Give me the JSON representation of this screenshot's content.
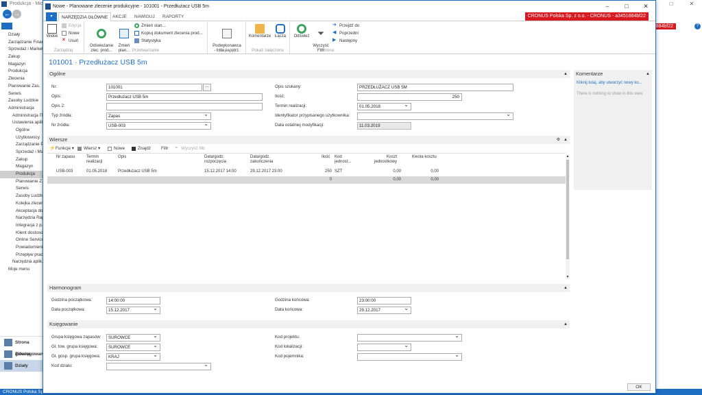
{
  "background": {
    "title": "Produkcja - Mic...",
    "company_status": "CRONUS Polska Sp. z o.o.",
    "red_badge": "o. - a3451884bf22",
    "nav_items": [
      "Działy",
      "Zarządzanie Finansami",
      "Sprzedaż i Marketing",
      "Zakup",
      "Magazyn",
      "Produkcja",
      "Zlecenia",
      "Planowanie Zas.",
      "Serwis",
      "Zasoby Ludzkie",
      "Administracja",
      "Administracja IT",
      "Ustawienia aplikacji",
      "Ogólne",
      "Użytkownicy",
      "Zarządzanie Pr.",
      "Sprzedaż i Ma.",
      "Zakup",
      "Magazyn",
      "Produkcja",
      "Planowanie Z.",
      "Serwis",
      "Zasoby Ludzk.",
      "Kolejka zlecenia",
      "Akceptacja do.",
      "Narzędzia Rap.",
      "Integracja z p.",
      "Klient dostosow.",
      "Online Service",
      "Powiadomienia",
      "Przepływ prac.",
      "Narzędzia aplik.",
      "Moje menu"
    ],
    "bottom_items": [
      "Strona główna",
      "Zaksięgowane",
      "Działy"
    ],
    "win_controls": [
      "–",
      "□",
      "✕"
    ]
  },
  "dialog": {
    "title": "Nowe - Planowane zlecenie produkcyjne - 101001 - Przedłużacz USB 5m",
    "controls": [
      "–",
      "□",
      "✕"
    ],
    "company_badge": "CRONUS Polska Sp. z o.o. - CRONUS - a3451884bf22",
    "tabs": [
      "NARZĘDZIA GŁÓWNE",
      "AKCJE",
      "NAWIGUJ",
      "RAPORTY"
    ],
    "ribbon": {
      "zarzadzaj": {
        "label": "Zarządzaj",
        "widok": "Widok",
        "edycja": "Edycja",
        "nowe": "Nowe",
        "usun": "Usuń"
      },
      "przetwarzanie": {
        "label": "Przetwarzanie",
        "odswiezanie": "Odświeżanie\nzlec. prod...",
        "zmien_plan": "Zmień\nplan...",
        "zmien_stan": "Zmień stan...",
        "kopiuj": "Kopiuj dokument zlecenia prod...",
        "statystyka": "Statystyka"
      },
      "raporty": {
        "label": "Raporty",
        "podwykonawca": "Podwykonawca\n- lista zapotrz."
      },
      "pokaz": {
        "label": "Pokaż załączone",
        "komentarze": "Komentarze",
        "lacza": "Łącza"
      },
      "strona": {
        "label": "Strona",
        "odswiez": "Odśwież",
        "wyczysc": "Wyczyść\nFiltr",
        "przejdz": "Przejdź do",
        "poprzedni": "Poprzedni",
        "nastepny": "Następny"
      }
    },
    "page_title": "101001 · Przedłużacz USB 5m",
    "general": {
      "header": "Ogólne",
      "nr_label": "Nr:",
      "nr": "101001",
      "opis_label": "Opis:",
      "opis": "Przedłużacz USB 5m",
      "opis2_label": "Opis 2:",
      "opis2": "",
      "typ_label": "Typ źródła:",
      "typ": "Zapas",
      "nrzrodla_label": "Nr źródła:",
      "nrzrodla": "USB-003",
      "opis_szukany_label": "Opis szukany:",
      "opis_szukany": "PRZEDŁUŻACZ USB 5M",
      "ilosc_label": "Ilość:",
      "ilosc": "250",
      "termin_label": "Termin realizacji:",
      "termin": "01.05.2018",
      "ident_label": "Identyfikator przypisanego użytkownika:",
      "ident": "",
      "data_mod_label": "Data ostatniej modyfikacji:",
      "data_mod": "11.03.2019"
    },
    "comments": {
      "header": "Komentarze",
      "link": "Kliknij tutaj, aby utworzyć nowy ko...",
      "empty": "There is nothing to show in this view."
    },
    "lines": {
      "header": "Wiersze",
      "toolbar": {
        "funkcje": "Funkcje",
        "wiersz": "Wiersz",
        "nowe": "Nowe",
        "znajdz": "Znajdź",
        "filtr": "Filtr",
        "wyczysc": "Wyczyść filtr"
      },
      "columns": [
        "Nr zapasu",
        "Termin\nrealizacji",
        "Opis",
        "Data/godz.\nrozpoczęcia",
        "Data/godz.\nzakończenia",
        "Ilość",
        "Kod\njednost...",
        "Koszt\njednostkowy",
        "Kwota kosztu"
      ],
      "rows": [
        {
          "nr": "USB-003",
          "termin": "01.05.2018",
          "opis": "Przedłużacz USB 5m",
          "start": "15.12.2017 14:00",
          "koniec": "29.12.2017 23:00",
          "ilosc": "250",
          "jedn": "SZT",
          "koszt": "0,00",
          "kwota": "0,00"
        },
        {
          "nr": "",
          "termin": "",
          "opis": "",
          "start": "",
          "koniec": "",
          "ilosc": "0",
          "jedn": "",
          "koszt": "0,00",
          "kwota": "0,00"
        }
      ]
    },
    "harmonogram": {
      "header": "Harmonogram",
      "godz_pocz_label": "Godzina początkowa:",
      "godz_pocz": "14:00:00",
      "data_pocz_label": "Data początkowa:",
      "data_pocz": "15.12.2017",
      "godz_konc_label": "Godzina końcowa:",
      "godz_konc": "23:00:00",
      "data_konc_label": "Data końcowa:",
      "data_konc": "29.12.2017"
    },
    "ksiegowanie": {
      "header": "Księgowanie",
      "grupa_zap_label": "Grupa księgowa zapasów:",
      "grupa_zap": "SUROWCE",
      "gl_tow_label": "Gł. tow. grupa księgowa:",
      "gl_tow": "SUROWCE",
      "gl_gosp_label": "Gł. gosp. grupa księgowa:",
      "gl_gosp": "KRAJ",
      "kod_dzialu_label": "Kod działu:",
      "kod_dzialu": "",
      "kod_proj_label": "Kod projektu:",
      "kod_proj": "",
      "kod_lok_label": "Kod lokalizacji:",
      "kod_lok": "",
      "kod_poj_label": "Kod pojemnika:",
      "kod_poj": ""
    },
    "ok": "OK"
  }
}
